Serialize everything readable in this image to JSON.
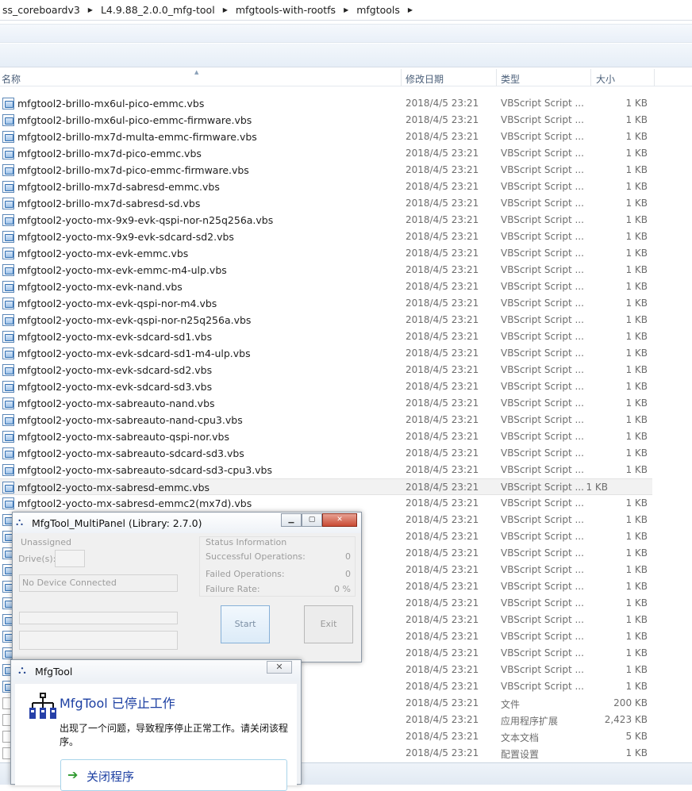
{
  "breadcrumb": [
    "ss_coreboardv3",
    "L4.9.88_2.0.0_mfg-tool",
    "mfgtools-with-rootfs",
    "mfgtools"
  ],
  "columns": {
    "name": "名称",
    "date": "修改日期",
    "type": "类型",
    "size": "大小"
  },
  "files": [
    {
      "name": "mfgtool2-brillo-mx6ul-pico-emmc.vbs",
      "date": "2018/4/5 23:21",
      "type": "VBScript Script ...",
      "size": "1 KB"
    },
    {
      "name": "mfgtool2-brillo-mx6ul-pico-emmc-firmware.vbs",
      "date": "2018/4/5 23:21",
      "type": "VBScript Script ...",
      "size": "1 KB"
    },
    {
      "name": "mfgtool2-brillo-mx7d-multa-emmc-firmware.vbs",
      "date": "2018/4/5 23:21",
      "type": "VBScript Script ...",
      "size": "1 KB"
    },
    {
      "name": "mfgtool2-brillo-mx7d-pico-emmc.vbs",
      "date": "2018/4/5 23:21",
      "type": "VBScript Script ...",
      "size": "1 KB"
    },
    {
      "name": "mfgtool2-brillo-mx7d-pico-emmc-firmware.vbs",
      "date": "2018/4/5 23:21",
      "type": "VBScript Script ...",
      "size": "1 KB"
    },
    {
      "name": "mfgtool2-brillo-mx7d-sabresd-emmc.vbs",
      "date": "2018/4/5 23:21",
      "type": "VBScript Script ...",
      "size": "1 KB"
    },
    {
      "name": "mfgtool2-brillo-mx7d-sabresd-sd.vbs",
      "date": "2018/4/5 23:21",
      "type": "VBScript Script ...",
      "size": "1 KB"
    },
    {
      "name": "mfgtool2-yocto-mx-9x9-evk-qspi-nor-n25q256a.vbs",
      "date": "2018/4/5 23:21",
      "type": "VBScript Script ...",
      "size": "1 KB"
    },
    {
      "name": "mfgtool2-yocto-mx-9x9-evk-sdcard-sd2.vbs",
      "date": "2018/4/5 23:21",
      "type": "VBScript Script ...",
      "size": "1 KB"
    },
    {
      "name": "mfgtool2-yocto-mx-evk-emmc.vbs",
      "date": "2018/4/5 23:21",
      "type": "VBScript Script ...",
      "size": "1 KB"
    },
    {
      "name": "mfgtool2-yocto-mx-evk-emmc-m4-ulp.vbs",
      "date": "2018/4/5 23:21",
      "type": "VBScript Script ...",
      "size": "1 KB"
    },
    {
      "name": "mfgtool2-yocto-mx-evk-nand.vbs",
      "date": "2018/4/5 23:21",
      "type": "VBScript Script ...",
      "size": "1 KB"
    },
    {
      "name": "mfgtool2-yocto-mx-evk-qspi-nor-m4.vbs",
      "date": "2018/4/5 23:21",
      "type": "VBScript Script ...",
      "size": "1 KB"
    },
    {
      "name": "mfgtool2-yocto-mx-evk-qspi-nor-n25q256a.vbs",
      "date": "2018/4/5 23:21",
      "type": "VBScript Script ...",
      "size": "1 KB"
    },
    {
      "name": "mfgtool2-yocto-mx-evk-sdcard-sd1.vbs",
      "date": "2018/4/5 23:21",
      "type": "VBScript Script ...",
      "size": "1 KB"
    },
    {
      "name": "mfgtool2-yocto-mx-evk-sdcard-sd1-m4-ulp.vbs",
      "date": "2018/4/5 23:21",
      "type": "VBScript Script ...",
      "size": "1 KB"
    },
    {
      "name": "mfgtool2-yocto-mx-evk-sdcard-sd2.vbs",
      "date": "2018/4/5 23:21",
      "type": "VBScript Script ...",
      "size": "1 KB"
    },
    {
      "name": "mfgtool2-yocto-mx-evk-sdcard-sd3.vbs",
      "date": "2018/4/5 23:21",
      "type": "VBScript Script ...",
      "size": "1 KB"
    },
    {
      "name": "mfgtool2-yocto-mx-sabreauto-nand.vbs",
      "date": "2018/4/5 23:21",
      "type": "VBScript Script ...",
      "size": "1 KB"
    },
    {
      "name": "mfgtool2-yocto-mx-sabreauto-nand-cpu3.vbs",
      "date": "2018/4/5 23:21",
      "type": "VBScript Script ...",
      "size": "1 KB"
    },
    {
      "name": "mfgtool2-yocto-mx-sabreauto-qspi-nor.vbs",
      "date": "2018/4/5 23:21",
      "type": "VBScript Script ...",
      "size": "1 KB"
    },
    {
      "name": "mfgtool2-yocto-mx-sabreauto-sdcard-sd3.vbs",
      "date": "2018/4/5 23:21",
      "type": "VBScript Script ...",
      "size": "1 KB"
    },
    {
      "name": "mfgtool2-yocto-mx-sabreauto-sdcard-sd3-cpu3.vbs",
      "date": "2018/4/5 23:21",
      "type": "VBScript Script ...",
      "size": "1 KB"
    },
    {
      "name": "mfgtool2-yocto-mx-sabresd-emmc.vbs",
      "date": "2018/4/5 23:21",
      "type": "VBScript Script ...",
      "size": "1 KB",
      "selected": true
    },
    {
      "name": "mfgtool2-yocto-mx-sabresd-emmc2(mx7d).vbs",
      "date": "2018/4/5 23:21",
      "type": "VBScript Script ...",
      "size": "1 KB"
    },
    {
      "name": "",
      "date": "2018/4/5 23:21",
      "type": "VBScript Script ...",
      "size": "1 KB"
    },
    {
      "name": "",
      "date": "2018/4/5 23:21",
      "type": "VBScript Script ...",
      "size": "1 KB"
    },
    {
      "name": "",
      "date": "2018/4/5 23:21",
      "type": "VBScript Script ...",
      "size": "1 KB"
    },
    {
      "name": "",
      "date": "2018/4/5 23:21",
      "type": "VBScript Script ...",
      "size": "1 KB"
    },
    {
      "name": "",
      "date": "2018/4/5 23:21",
      "type": "VBScript Script ...",
      "size": "1 KB"
    },
    {
      "name": "",
      "date": "2018/4/5 23:21",
      "type": "VBScript Script ...",
      "size": "1 KB"
    },
    {
      "name": "",
      "date": "2018/4/5 23:21",
      "type": "VBScript Script ...",
      "size": "1 KB"
    },
    {
      "name": "",
      "date": "2018/4/5 23:21",
      "type": "VBScript Script ...",
      "size": "1 KB"
    },
    {
      "name": "",
      "date": "2018/4/5 23:21",
      "type": "VBScript Script ...",
      "size": "1 KB"
    },
    {
      "name": "",
      "date": "2018/4/5 23:21",
      "type": "VBScript Script ...",
      "size": "1 KB"
    },
    {
      "name": "",
      "date": "2018/4/5 23:21",
      "type": "VBScript Script ...",
      "size": "1 KB"
    },
    {
      "name": "",
      "date": "2018/4/5 23:21",
      "type": "文件",
      "size": "200 KB",
      "plain": true
    },
    {
      "name": "",
      "date": "2018/4/5 23:21",
      "type": "应用程序扩展",
      "size": "2,423 KB",
      "plain": true
    },
    {
      "name": "",
      "date": "2018/4/5 23:21",
      "type": "文本文档",
      "size": "5 KB",
      "plain": true
    },
    {
      "name": "",
      "date": "2018/4/5 23:21",
      "type": "配置设置",
      "size": "1 KB",
      "plain": true
    }
  ],
  "multipanel": {
    "title": "MfgTool_MultiPanel (Library: 2.7.0)",
    "unassigned": "Unassigned",
    "drives_label": "Drive(s):",
    "no_device": "No Device Connected",
    "status_info": "Status Information",
    "successful_label": "Successful Operations:",
    "successful_value": "0",
    "failed_label": "Failed Operations:",
    "failed_value": "0",
    "failure_rate_label": "Failure Rate:",
    "failure_rate_value": "0 %",
    "start_label": "Start",
    "exit_label": "Exit"
  },
  "crash_dialog": {
    "title": "MfgTool",
    "heading": "MfgTool 已停止工作",
    "message": "出现了一个问题，导致程序停止正常工作。请关闭该程序。",
    "action_label": "关闭程序"
  }
}
